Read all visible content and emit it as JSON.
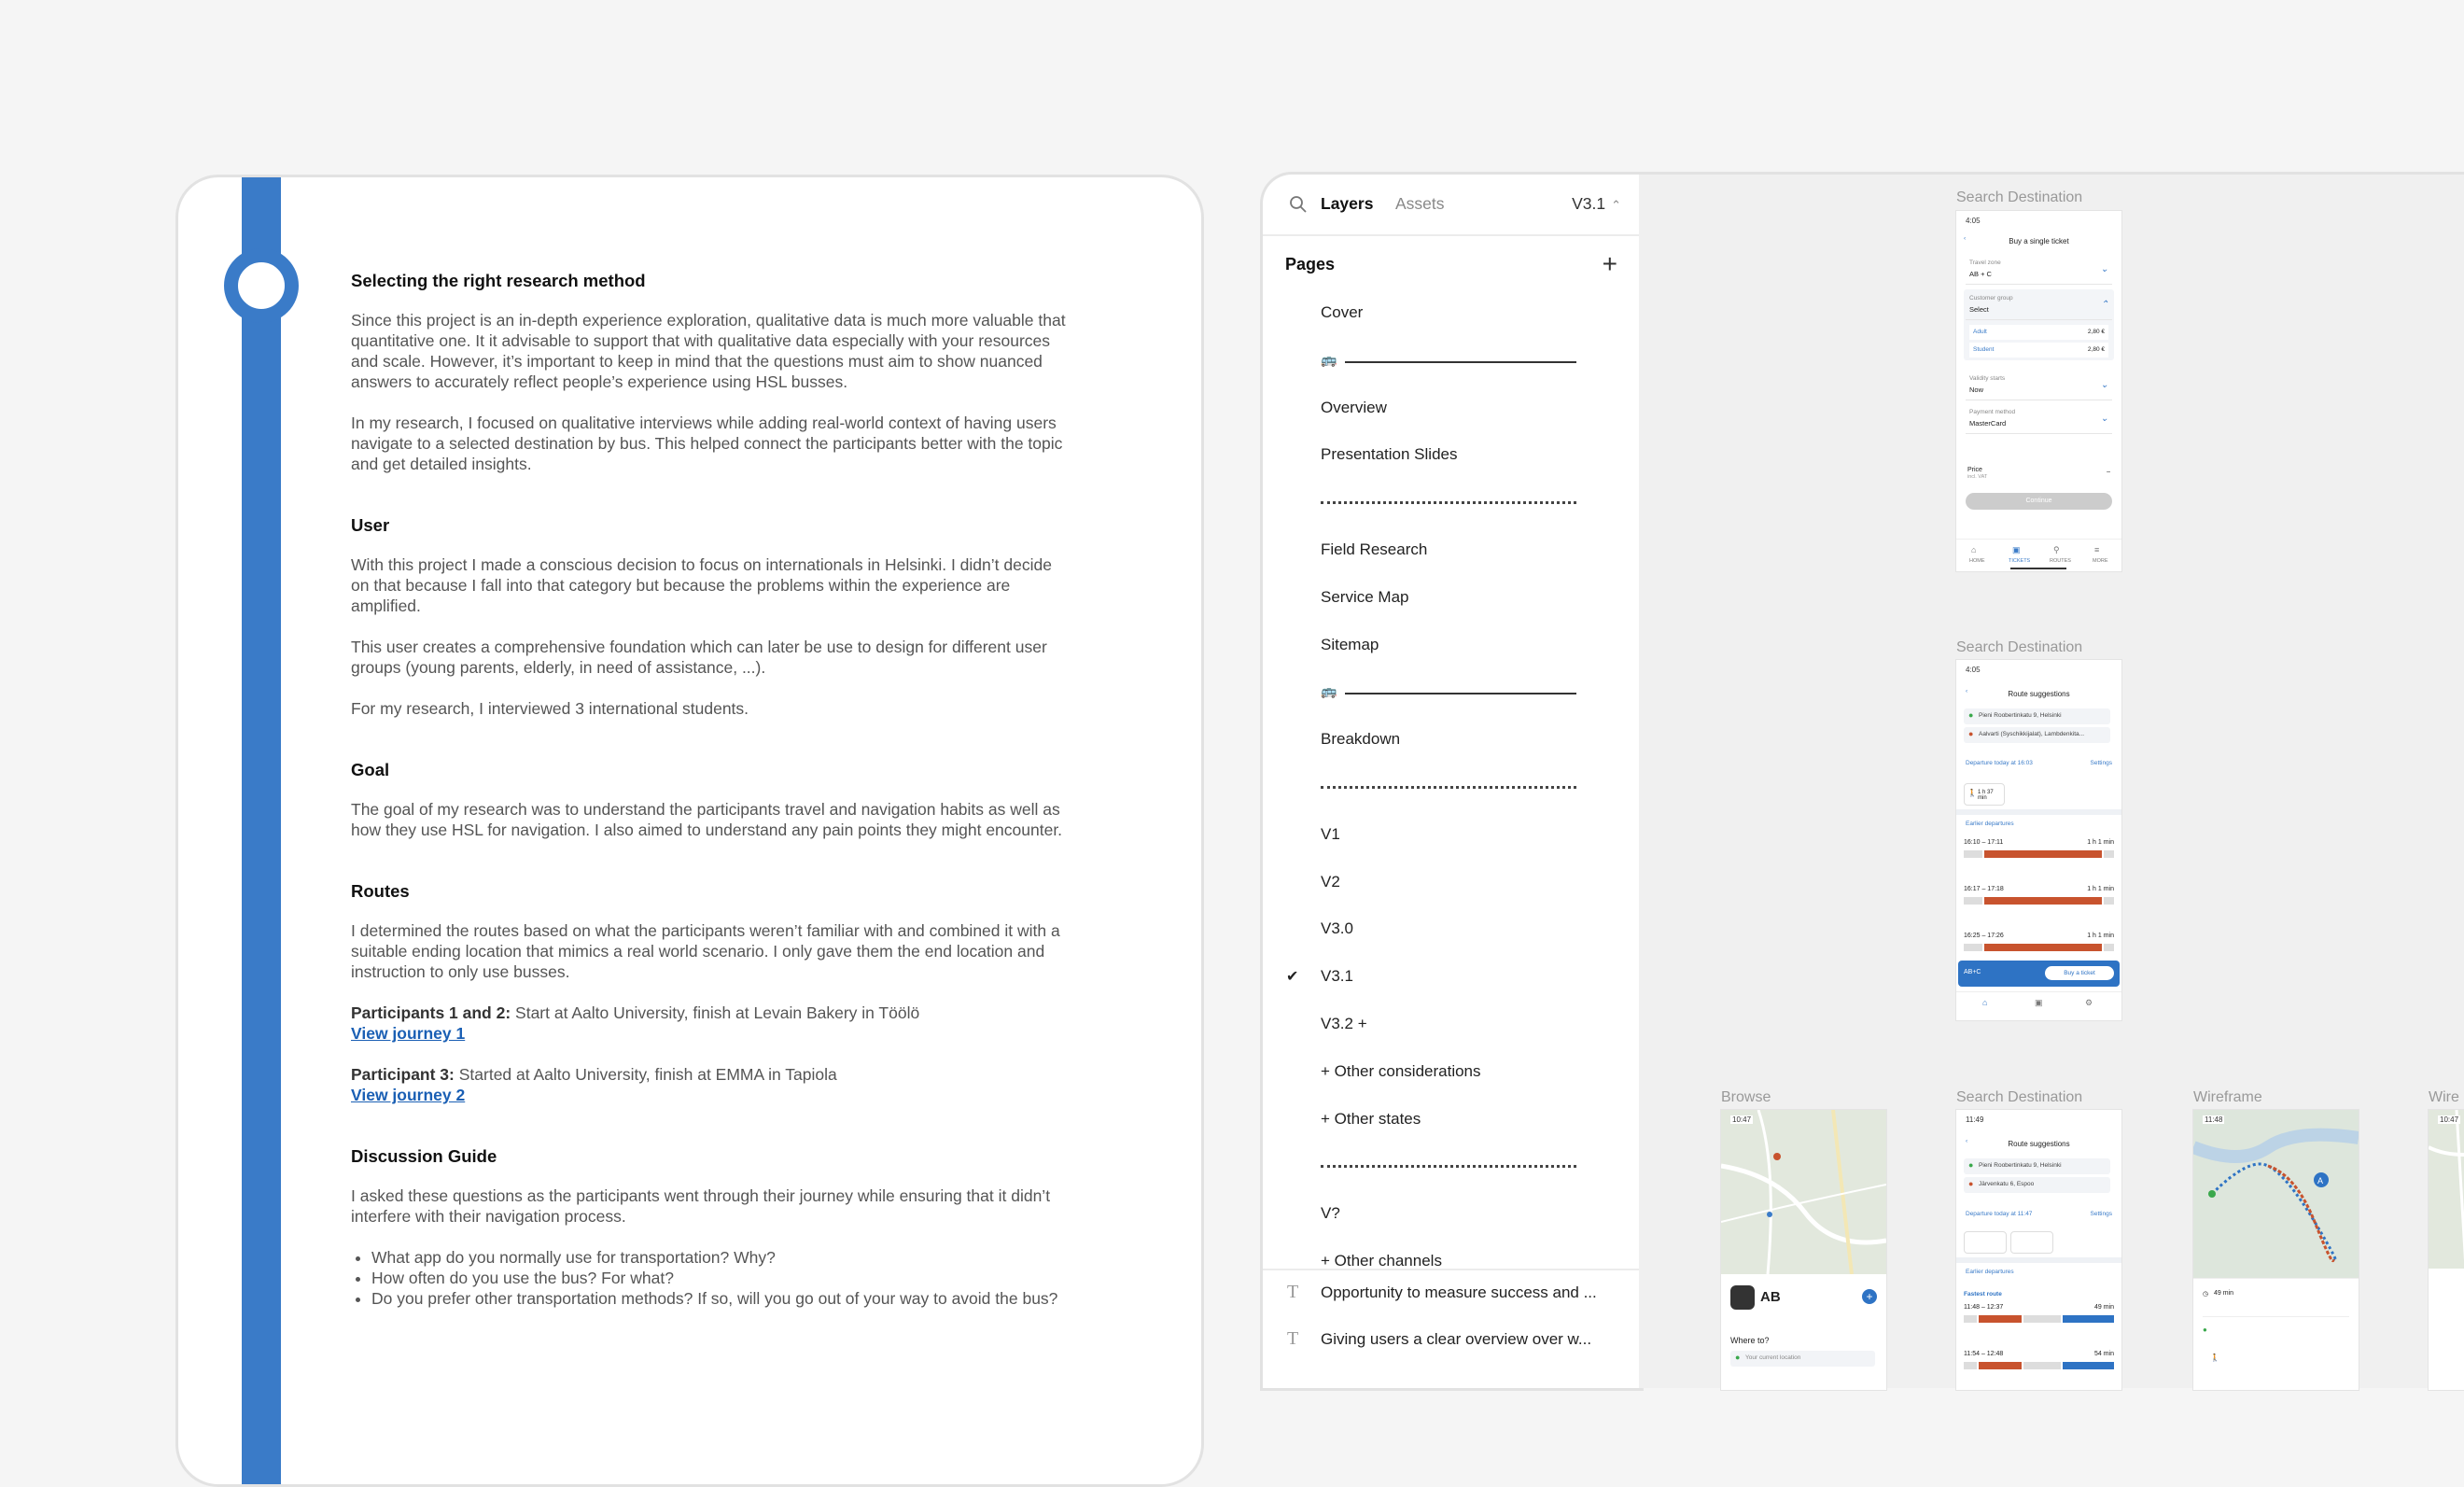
{
  "doc": {
    "sections": [
      {
        "heading": "Selecting the right research method",
        "paragraphs": [
          "Since this project is an in-depth experience exploration, qualitative data is much more valuable that quantitative one. It it advisable to support that with qualitative data especially with your resources and scale. However, it’s important to keep in mind that the questions must aim to show nuanced answers to accurately reflect people’s experience using HSL busses.",
          "In my research, I focused on qualitative interviews while adding real-world context of having users navigate to a selected destination by bus. This helped connect the participants better with the topic and get detailed insights."
        ]
      },
      {
        "heading": "User",
        "paragraphs": [
          "With this project I made a conscious decision to focus on internationals in Helsinki. I didn’t decide on that because I fall into that category but because the problems within the experience are amplified.",
          "This user creates a comprehensive foundation which can later be use to design for different user groups (young parents, elderly, in need of assistance, ...).",
          "For my research, I interviewed 3 international students."
        ]
      },
      {
        "heading": "Goal",
        "paragraphs": [
          "The goal of my research was to understand the participants travel and navigation habits as well as how they use HSL for navigation. I also aimed to understand any pain points they might encounter."
        ]
      },
      {
        "heading": "Routes",
        "paragraphs": [
          "I determined the routes based on what the participants weren’t familiar with and combined it with a suitable ending location that mimics a real world scenario. I only gave them the end location and instruction to only use busses."
        ]
      },
      {
        "heading": "Discussion Guide",
        "paragraphs": [
          "I asked these questions as the participants went through their journey while ensuring that it didn’t interfere with their navigation process."
        ]
      }
    ],
    "participants": [
      {
        "label": "Participants 1 and 2:",
        "text": " Start at Aalto University, finish at Levain Bakery in Töölö",
        "link": "View journey 1"
      },
      {
        "label": "Participant 3:",
        "text": " Started at Aalto University, finish at EMMA in Tapiola",
        "link": "View journey 2"
      }
    ],
    "questions": [
      "What app do you normally use for transportation? Why?",
      "How often do you use the bus? For what?",
      "Do you prefer other transportation methods? If so, will you go out of your way to avoid the bus?"
    ]
  },
  "panel": {
    "tab_layers": "Layers",
    "tab_assets": "Assets",
    "version": "V3.1",
    "pages_title": "Pages",
    "pages": [
      {
        "type": "label",
        "label": "Cover"
      },
      {
        "type": "bus-line"
      },
      {
        "type": "label",
        "label": "Overview"
      },
      {
        "type": "label",
        "label": "Presentation Slides"
      },
      {
        "type": "dots"
      },
      {
        "type": "label",
        "label": "Field Research"
      },
      {
        "type": "label",
        "label": "Service Map"
      },
      {
        "type": "label",
        "label": "Sitemap"
      },
      {
        "type": "bus-line"
      },
      {
        "type": "label",
        "label": "Breakdown"
      },
      {
        "type": "dots"
      },
      {
        "type": "label",
        "label": "V1"
      },
      {
        "type": "label",
        "label": "V2"
      },
      {
        "type": "label",
        "label": "V3.0"
      },
      {
        "type": "label",
        "label": "V3.1",
        "selected": true
      },
      {
        "type": "label",
        "label": "V3.2 +"
      },
      {
        "type": "label",
        "label": "+ Other considerations"
      },
      {
        "type": "label",
        "label": "+ Other states"
      },
      {
        "type": "dots"
      },
      {
        "type": "label",
        "label": "V?"
      },
      {
        "type": "label",
        "label": "+ Other channels"
      }
    ],
    "layers": [
      "Opportunity to measure success and ...",
      "Giving users a clear overview over w..."
    ]
  },
  "canvas": {
    "frame_labels": [
      "Search Destination",
      "Search Destination",
      "Browse",
      "Search Destination",
      "Wireframe",
      "Wire"
    ],
    "phone1": {
      "status": "4:05",
      "title": "Buy a single ticket",
      "zone_label": "Travel zone",
      "zone_value": "AB + C",
      "group_label": "Customer group",
      "group_value": "Select",
      "adult": "Adult",
      "adult_price": "2,80 €",
      "student": "Student",
      "student_price": "2,80 €",
      "validity_label": "Validity starts",
      "validity_value": "Now",
      "payment_label": "Payment method",
      "payment_value": "MasterCard",
      "price_label": "Price",
      "price_sub": "incl. VAT",
      "price_value": "–",
      "continue": "Continue",
      "nav": [
        "HOME",
        "TICKETS",
        "ROUTES",
        "MORE"
      ]
    },
    "phone2": {
      "status": "4:05",
      "title": "Route suggestions",
      "from": "Pieni Roobertinkatu 9, Helsinki",
      "to": "Aalvarti (Syschikkijalat), Lambdenkita...",
      "departure": "Departure today at 16:03",
      "settings": "Settings",
      "walk": "1 h 37 min",
      "earlier": "Earlier departures",
      "trips": [
        {
          "times": "16:10 – 17:11",
          "dur": "1 h 1 min"
        },
        {
          "times": "16:17 – 17:18",
          "dur": "1 h 1 min"
        },
        {
          "times": "16:25 – 17:26",
          "dur": "1 h 1 min"
        }
      ],
      "zone": "AB+C",
      "buy": "Buy a ticket"
    },
    "phone3": {
      "status": "10:47",
      "zone": "AB",
      "where_to": "Where to?",
      "current": "Your current location"
    },
    "phone4": {
      "status": "11:49",
      "title": "Route suggestions",
      "from": "Pieni Roobertinkatu 9, Helsinki",
      "to": "Järvenkatu 6, Espoo",
      "departure": "Departure today at 11:47",
      "settings": "Settings",
      "earlier": "Earlier departures",
      "fastest": "Fastest route",
      "trips": [
        {
          "times": "11:48 – 12:37",
          "dur": "49 min"
        },
        {
          "times": "11:54 – 12:48",
          "dur": "54 min"
        }
      ]
    },
    "phone5": {
      "status": "11:48",
      "walk": "49 min"
    },
    "phone6": {
      "status": "10:47"
    }
  },
  "colors": {
    "accent": "#3a7bc8",
    "bus_red": "#c8532e",
    "link": "#1a5fb4"
  }
}
